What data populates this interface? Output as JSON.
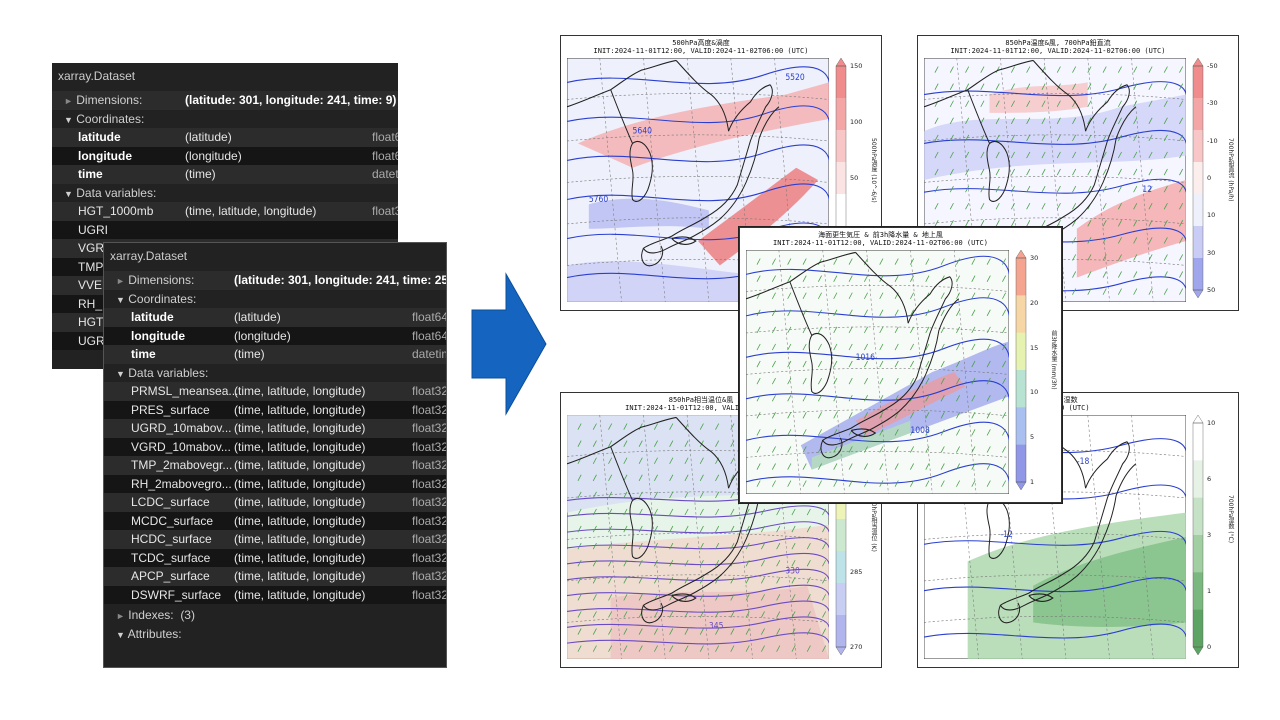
{
  "dataset_back": {
    "title": "xarray.Dataset",
    "dimensions_label": "Dimensions:",
    "dimensions_value": "(latitude: 301, longitude: 241, time: 9)",
    "coordinates_label": "Coordinates:",
    "coords": [
      {
        "name": "latitude",
        "dims": "(latitude)",
        "dtype": "float6"
      },
      {
        "name": "longitude",
        "dims": "(longitude)",
        "dtype": "float6"
      },
      {
        "name": "time",
        "dims": "(time)",
        "dtype": "datetime64[n"
      }
    ],
    "data_variables_label": "Data variables:",
    "vars": [
      {
        "name": "HGT_1000mb",
        "dims": "(time, latitude, longitude)",
        "dtype": "float3"
      },
      {
        "name": "UGRI",
        "dims": "",
        "dtype": ""
      },
      {
        "name": "VGRI",
        "dims": "",
        "dtype": ""
      },
      {
        "name": "TMP",
        "dims": "",
        "dtype": ""
      },
      {
        "name": "VVEL",
        "dims": "",
        "dtype": ""
      },
      {
        "name": "RH_",
        "dims": "",
        "dtype": ""
      },
      {
        "name": "HGT",
        "dims": "",
        "dtype": ""
      },
      {
        "name": "UGR",
        "dims": "",
        "dtype": ""
      }
    ]
  },
  "dataset_front": {
    "title": "xarray.Dataset",
    "dimensions_label": "Dimensions:",
    "dimensions_value": "(latitude: 301, longitude: 241, time: 25)",
    "coordinates_label": "Coordinates:",
    "coords": [
      {
        "name": "latitude",
        "dims": "(latitude)",
        "dtype": "float64"
      },
      {
        "name": "longitude",
        "dims": "(longitude)",
        "dtype": "float64"
      },
      {
        "name": "time",
        "dims": "(time)",
        "dtype": "datetime64[ns"
      }
    ],
    "data_variables_label": "Data variables:",
    "vars": [
      {
        "name": "PRMSL_meansea...",
        "dims": "(time, latitude, longitude)",
        "dtype": "float32"
      },
      {
        "name": "PRES_surface",
        "dims": "(time, latitude, longitude)",
        "dtype": "float32"
      },
      {
        "name": "UGRD_10mabov...",
        "dims": "(time, latitude, longitude)",
        "dtype": "float32"
      },
      {
        "name": "VGRD_10mabov...",
        "dims": "(time, latitude, longitude)",
        "dtype": "float32"
      },
      {
        "name": "TMP_2mabovegr...",
        "dims": "(time, latitude, longitude)",
        "dtype": "float32"
      },
      {
        "name": "RH_2mabovegro...",
        "dims": "(time, latitude, longitude)",
        "dtype": "float32"
      },
      {
        "name": "LCDC_surface",
        "dims": "(time, latitude, longitude)",
        "dtype": "float32"
      },
      {
        "name": "MCDC_surface",
        "dims": "(time, latitude, longitude)",
        "dtype": "float32"
      },
      {
        "name": "HCDC_surface",
        "dims": "(time, latitude, longitude)",
        "dtype": "float32"
      },
      {
        "name": "TCDC_surface",
        "dims": "(time, latitude, longitude)",
        "dtype": "float32"
      },
      {
        "name": "APCP_surface",
        "dims": "(time, latitude, longitude)",
        "dtype": "float32"
      },
      {
        "name": "DSWRF_surface",
        "dims": "(time, latitude, longitude)",
        "dtype": "float32"
      }
    ],
    "indexes_label": "Indexes:",
    "indexes_count": "(3)",
    "attributes_label": "Attributes:"
  },
  "arrow_color": "#1464c0",
  "maps": {
    "tl": {
      "title1": "500hPa高度&渦度",
      "title2": "INIT:2024-11-01T12:00, VALID:2024-11-02T06:00 (UTC)",
      "ticks": [
        "150",
        "100",
        "50",
        "0",
        "-50"
      ],
      "cbar_label": "500hPa渦度 (10^-6/s)",
      "contours": [
        "5520",
        "5640",
        "5760",
        "5880"
      ]
    },
    "tr": {
      "title1": "850hPa温度&風, 700hPa鉛直流",
      "title2": "INIT:2024-11-01T12:00, VALID:2024-11-02T06:00 (UTC)",
      "ticks": [
        "-50",
        "-30",
        "-10",
        "0",
        "10",
        "30",
        "50"
      ],
      "cbar_label": "700hPa鉛直流 (hPa/h)",
      "contours": [
        "12"
      ]
    },
    "center": {
      "title1": "海面更生気圧 & 前3h降水量 & 地上風",
      "title2": "INIT:2024-11-01T12:00, VALID:2024-11-02T06:00 (UTC)",
      "ticks": [
        "30",
        "20",
        "15",
        "10",
        "5",
        "1"
      ],
      "cbar_label": "前3h降水量 (mm/3h)",
      "contours": [
        "1016",
        "1008"
      ]
    },
    "bl": {
      "title1": "850hPa相当温位&風",
      "title2": "INIT:2024-11-01T12:00, VALID:2024-11",
      "ticks": [
        "315",
        "300",
        "285",
        "270"
      ],
      "cbar_label": "850hPa相当温位 (K)",
      "contours": [
        "330",
        "345"
      ]
    },
    "br": {
      "title1": "700hPa湿数",
      "title2": "-02T06:00 (UTC)",
      "title2b": "2024-11-01T12:00, VALID:2024-11",
      "ticks": [
        "10",
        "6",
        "3",
        "1",
        "0"
      ],
      "cbar_label": "700hPa湿数 (°C)",
      "contours": [
        "-18",
        "-12"
      ]
    }
  }
}
